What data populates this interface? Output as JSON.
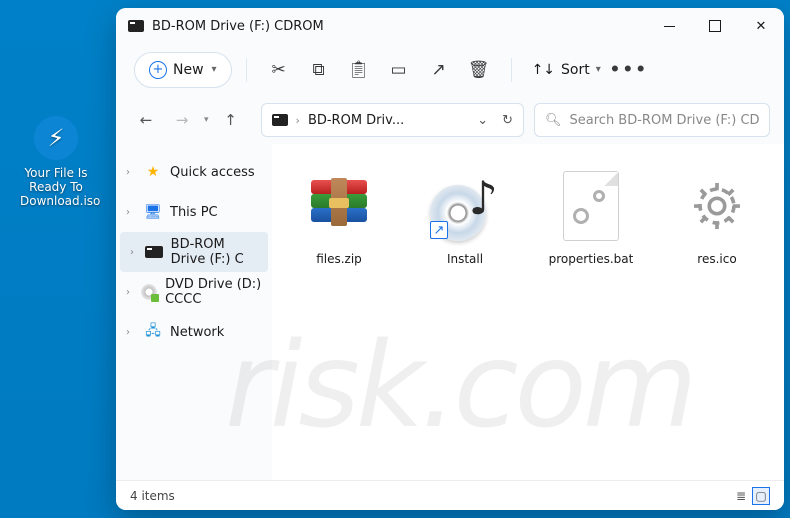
{
  "desktop": {
    "iso_label_line1": "Your File Is",
    "iso_label_line2": "Ready To",
    "iso_label_line3": "Download.iso"
  },
  "window": {
    "title": "BD-ROM Drive (F:) CDROM"
  },
  "toolbar": {
    "new_label": "New",
    "sort_label": "Sort"
  },
  "addressbar": {
    "path_display": "BD-ROM Driv..."
  },
  "search": {
    "placeholder": "Search BD-ROM Drive (F:) CDROM"
  },
  "sidebar": {
    "items": [
      {
        "label": "Quick access"
      },
      {
        "label": "This PC"
      },
      {
        "label": "BD-ROM Drive (F:) C"
      },
      {
        "label": "DVD Drive (D:) CCCC"
      },
      {
        "label": "Network"
      }
    ]
  },
  "files": [
    {
      "name": "files.zip"
    },
    {
      "name": "Install"
    },
    {
      "name": "properties.bat"
    },
    {
      "name": "res.ico"
    }
  ],
  "statusbar": {
    "count": "4 items"
  },
  "watermark": "risk.com"
}
